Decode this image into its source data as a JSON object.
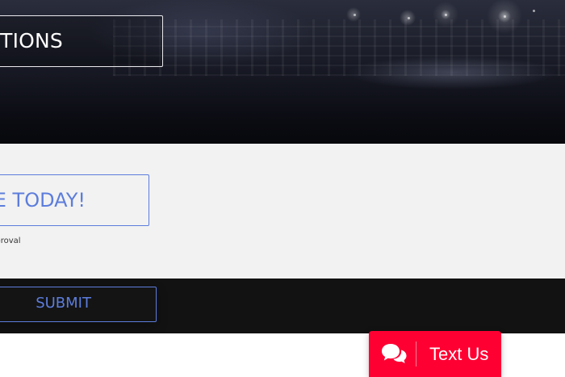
{
  "hero": {
    "button_label": "CTIONS"
  },
  "content": {
    "cta_label": "ME TODAY!",
    "approval_note": "pproval"
  },
  "form": {
    "submit_label": "SUBMIT"
  },
  "text_us": {
    "label": "Text Us",
    "icon": "chat-bubbles-icon"
  },
  "colors": {
    "accent": "#5c7ddc",
    "text_us_background": "#ff0033",
    "form_bar_background": "#121212",
    "content_background": "#f2f2f2"
  }
}
